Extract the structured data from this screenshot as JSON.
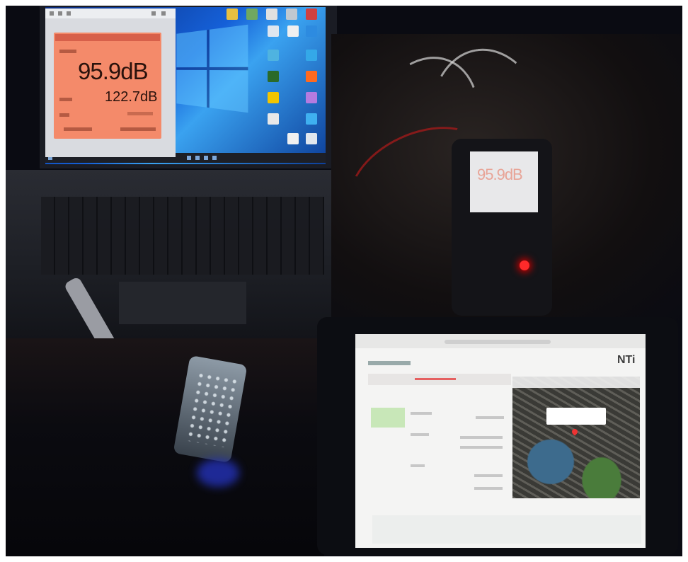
{
  "laptop": {
    "sound_window": {
      "main_level": "95.9dB",
      "peak_level": "122.7dB"
    }
  },
  "meter": {
    "display_value": "95.9dB"
  },
  "tablet": {
    "logo": "NTi"
  },
  "colors": {
    "meter_panel": "#f48a6a",
    "led": "#ff2a2a",
    "desktop": "#1560d8"
  }
}
